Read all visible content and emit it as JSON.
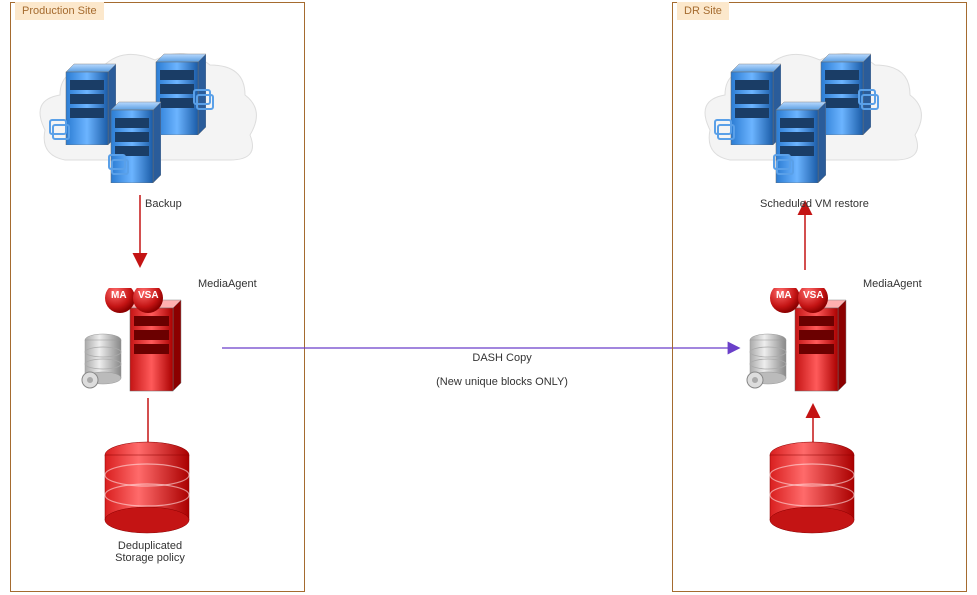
{
  "production": {
    "title": "Production Site",
    "backup_label": "Backup",
    "media_agent_label": "MediaAgent",
    "ma_badge": "MA",
    "vsa_badge": "VSA",
    "storage_label": "Deduplicated\nStorage policy"
  },
  "dr": {
    "title": "DR Site",
    "restore_label": "Scheduled VM restore",
    "media_agent_label": "MediaAgent",
    "ma_badge": "MA",
    "vsa_badge": "VSA"
  },
  "dash_copy": {
    "line1": "DASH Copy",
    "line2": "(New unique blocks ONLY)"
  }
}
